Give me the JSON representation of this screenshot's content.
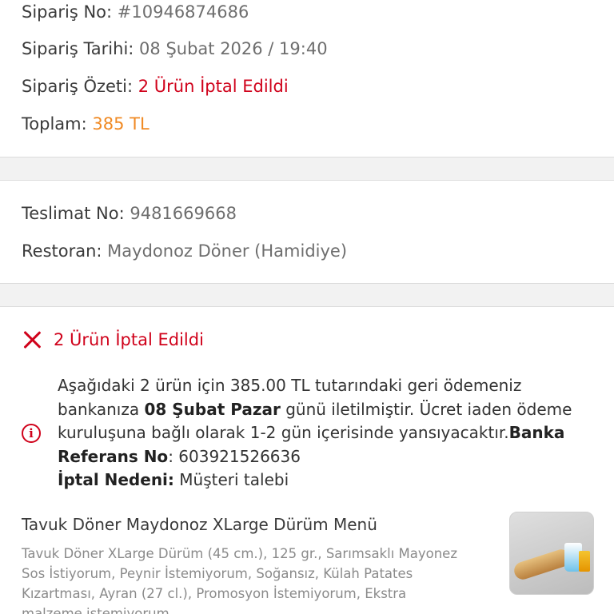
{
  "order": {
    "no_label": "Sipariş No:",
    "no_value": "#10946874686",
    "date_label": "Sipariş Tarihi:",
    "date_value": "08 Şubat 2026 / 19:40",
    "summary_label": "Sipariş Özeti:",
    "summary_value": "2 Ürün İptal Edildi",
    "total_label": "Toplam:",
    "total_value": "385 TL"
  },
  "delivery": {
    "no_label": "Teslimat No:",
    "no_value": "9481669668",
    "restaurant_label": "Restoran:",
    "restaurant_value": "Maydonoz Döner (Hamidiye)"
  },
  "cancellation": {
    "title": "2 Ürün İptal Edildi",
    "text_1": "Aşağıdaki 2 ürün için 385.00 TL tutarındaki geri ödemeniz bankanıza ",
    "date_bold": "08 Şubat Pazar",
    "text_2": " günü iletilmiştir. Ücret iaden ödeme kuruluşuna bağlı olarak 1-2 gün içerisinde yansıyacaktır.",
    "ref_label": "Banka Referans No",
    "ref_value": ": 603921526636",
    "reason_label": "İptal Nedeni:",
    "reason_value": " Müşteri talebi"
  },
  "product": {
    "title": "Tavuk Döner Maydonoz XLarge Dürüm Menü",
    "description": "Tavuk Döner XLarge Dürüm (45 cm.), 125 gr., Sarımsaklı Mayonez Sos İstiyorum, Peynir İstemiyorum, Soğansız, Külah Patates Kızartması, Ayran (27 cl.), Promosyon İstemiyorum, Ekstra malzeme istemiyorum"
  },
  "colors": {
    "cancel_red": "#d0021b",
    "total_orange": "#f08a24"
  },
  "icons": {
    "cancel": "close-icon",
    "info": "info-icon"
  }
}
